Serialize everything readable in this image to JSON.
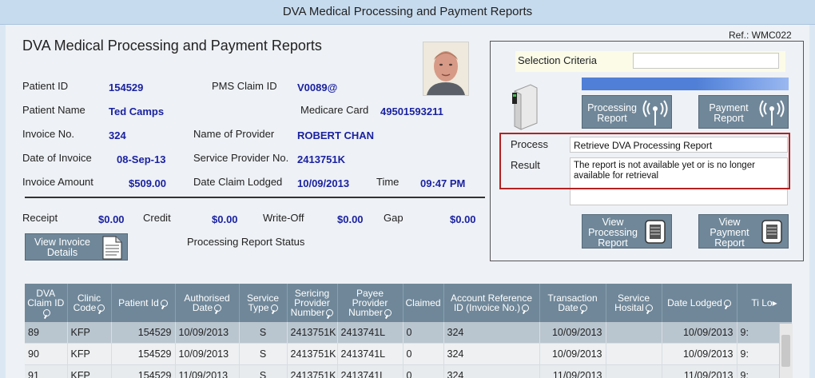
{
  "window": {
    "title": "DVA  Medical Processing and Payment Reports"
  },
  "ref": "Ref.: WMC022",
  "header": {
    "title": "DVA  Medical Processing and Payment Reports"
  },
  "fields": {
    "patient_id_label": "Patient ID",
    "patient_id": "154529",
    "pms_claim_id_label": "PMS Claim ID",
    "pms_claim_id": "V0089@",
    "patient_name_label": "Patient Name",
    "patient_name": "Ted Camps",
    "medicare_card_label": "Medicare Card",
    "medicare_card": "49501593211",
    "invoice_no_label": "Invoice No.",
    "invoice_no": "324",
    "provider_name_label": "Name of Provider",
    "provider_name": "ROBERT CHAN",
    "date_invoice_label": "Date of Invoice",
    "date_invoice": "08-Sep-13",
    "service_provider_no_label": "Service Provider No.",
    "service_provider_no": "2413751K",
    "invoice_amount_label": "Invoice Amount",
    "invoice_amount": "$509.00",
    "date_claim_lodged_label": "Date Claim Lodged",
    "date_claim_lodged": "10/09/2013",
    "time_label": "Time",
    "time": "09:47 PM"
  },
  "totals": {
    "receipt_label": "Receipt",
    "receipt": "$0.00",
    "credit_label": "Credit",
    "credit": "$0.00",
    "writeoff_label": "Write-Off",
    "writeoff": "$0.00",
    "gap_label": "Gap",
    "gap": "$0.00"
  },
  "view_invoice_button": "View Invoice Details",
  "processing_status_label": "Processing Report Status",
  "right_panel": {
    "selection_criteria_label": "Selection Criteria",
    "selection_criteria_value": "",
    "processing_report_button": "Processing Report",
    "payment_report_button": "Payment Report",
    "process_label": "Process",
    "process_value": "Retrieve DVA Processing Report",
    "result_label": "Result",
    "result_value": "The report is not available yet or is no longer available for retrieval",
    "view_processing_report_button": "View Processing Report",
    "view_payment_report_button": "View Payment Report"
  },
  "colors": {
    "accent": "#6f8799",
    "value_text": "#1a22a0",
    "highlight_border": "#b22222"
  },
  "table": {
    "columns": [
      "DVA Claim ID",
      "Clinic Code",
      "Patient Id",
      "Authorised Date",
      "Service Type",
      "Sericing Provider Number",
      "Payee Provider Number",
      "Claimed",
      "Account Reference ID (Invoice No.)",
      "Transaction Date",
      "Service Hosital",
      "Date Lodged",
      "Ti Lo"
    ],
    "rows": [
      [
        "89",
        "KFP",
        "154529",
        "10/09/2013",
        "S",
        "2413751K",
        "2413741L",
        "0",
        "324",
        "10/09/2013",
        "",
        "10/09/2013",
        "9:"
      ],
      [
        "90",
        "KFP",
        "154529",
        "10/09/2013",
        "S",
        "2413751K",
        "2413741L",
        "0",
        "324",
        "10/09/2013",
        "",
        "10/09/2013",
        "9:"
      ],
      [
        "91",
        "KFP",
        "154529",
        "11/09/2013",
        "S",
        "2413751K",
        "2413741L",
        "0",
        "324",
        "11/09/2013",
        "",
        "11/09/2013",
        "9:"
      ]
    ]
  }
}
